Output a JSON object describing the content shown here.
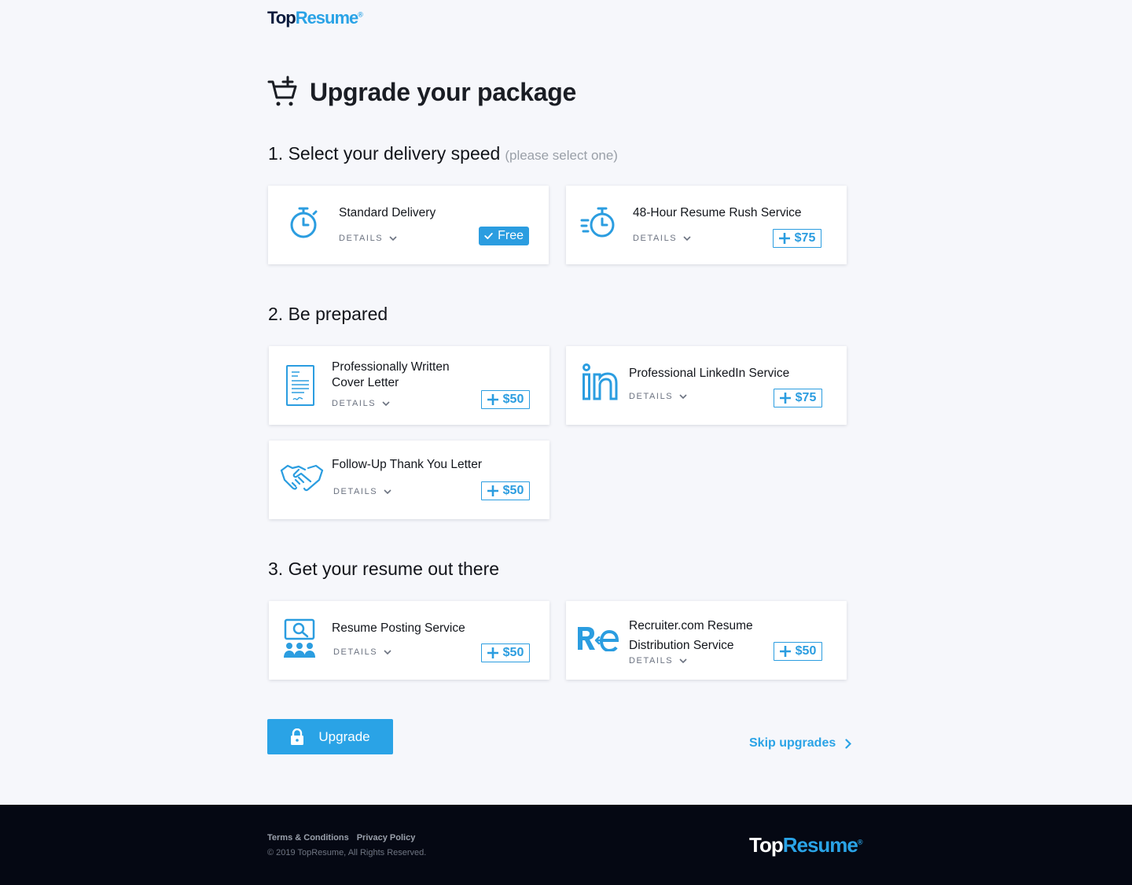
{
  "brand": {
    "name_top": "Top",
    "name_resume": "Resume",
    "mark": "®"
  },
  "page": {
    "title": "Upgrade your package"
  },
  "sections": {
    "delivery": {
      "heading": "1. Select your delivery speed",
      "hint": "(please select one)"
    },
    "prepared": {
      "heading": "2. Be prepared"
    },
    "out_there": {
      "heading": "3. Get your resume out there"
    }
  },
  "cards": {
    "standard": {
      "title": "Standard Delivery",
      "details": "DETAILS",
      "price": "Free"
    },
    "rush": {
      "title": "48-Hour Resume Rush Service",
      "details": "DETAILS",
      "price": "$75"
    },
    "cover": {
      "title_line1": "Professionally Written",
      "title_line2": "Cover Letter",
      "details": "DETAILS",
      "price": "$50"
    },
    "linkedin": {
      "title": "Professional LinkedIn Service",
      "details": "DETAILS",
      "price": "$75"
    },
    "thankyou": {
      "title": "Follow-Up Thank You Letter",
      "details": "DETAILS",
      "price": "$50"
    },
    "posting": {
      "title": "Resume Posting Service",
      "details": "DETAILS",
      "price": "$50"
    },
    "recruiter": {
      "title_line1": "Recruiter.com Resume",
      "title_line2": "Distribution Service",
      "details": "DETAILS",
      "price": "$50"
    }
  },
  "actions": {
    "upgrade": "Upgrade",
    "skip": "Skip upgrades"
  },
  "footer": {
    "terms": "Terms & Conditions",
    "privacy": "Privacy Policy",
    "copyright": "© 2019 TopResume, All Rights Reserved."
  },
  "colors": {
    "accent": "#2aa3e6",
    "price_border": "#2b9de0",
    "footer_bg": "#050813",
    "page_bg": "#f6f7fb"
  }
}
